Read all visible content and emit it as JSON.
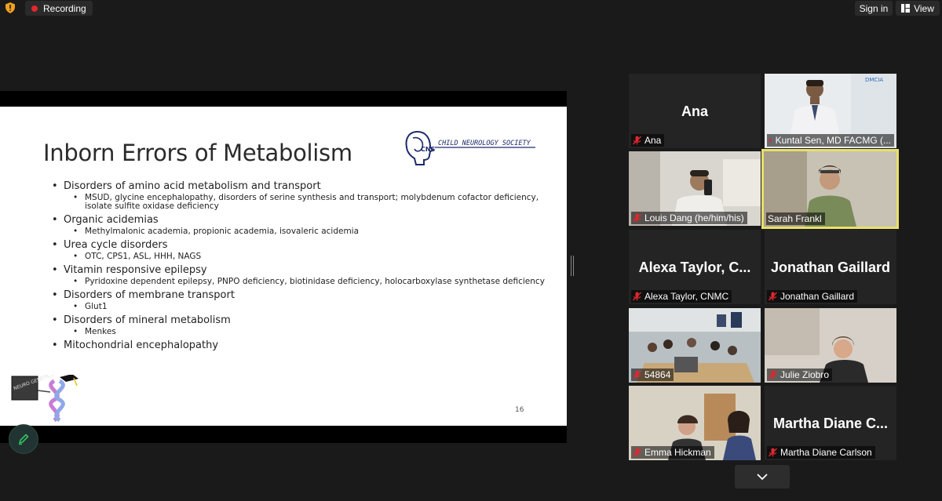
{
  "topbar": {
    "recording_label": "Recording",
    "signin_label": "Sign in",
    "view_label": "View"
  },
  "slide": {
    "title": "Inborn Errors of Metabolism",
    "logo_text": "CHILD NEUROLOGY SOCIETY",
    "logo_mark": "CNS",
    "sticker_text": "NEURO GENETICS",
    "page_number": "16",
    "bullets": [
      {
        "text": "Disorders of amino acid metabolism and transport",
        "sub": "MSUD, glycine encephalopathy, disorders of serine synthesis and transport; molybdenum cofactor deficiency, isolate sulfite oxidase deficiency"
      },
      {
        "text": "Organic acidemias",
        "sub": "Methylmalonic academia, propionic academia, isovaleric acidemia"
      },
      {
        "text": "Urea cycle disorders",
        "sub": "OTC, CPS1, ASL, HHH, NAGS"
      },
      {
        "text": "Vitamin responsive epilepsy",
        "sub": "Pyridoxine dependent epilepsy, PNPO deficiency, biotinidase deficiency, holocarboxylase synthetase deficiency"
      },
      {
        "text": "Disorders of membrane transport",
        "sub": "Glut1"
      },
      {
        "text": "Disorders of mineral metabolism",
        "sub": "Menkes"
      },
      {
        "text": "Mitochondrial encephalopathy",
        "sub": ""
      }
    ]
  },
  "participants": [
    {
      "big_name": "Ana",
      "label": "Ana"
    },
    {
      "big_name": "",
      "label": "Kuntal Sen, MD FACMG (...",
      "video_badge": "DMCIA"
    },
    {
      "big_name": "",
      "label": "Louis Dang (he/him/his)"
    },
    {
      "big_name": "",
      "label": "Sarah Frankl"
    },
    {
      "big_name": "Alexa  Taylor,  C...",
      "label": "Alexa Taylor, CNMC"
    },
    {
      "big_name": "Jonathan Gaillard",
      "label": "Jonathan Gaillard"
    },
    {
      "big_name": "",
      "label": "54864"
    },
    {
      "big_name": "",
      "label": "Julie Ziobro"
    },
    {
      "big_name": "",
      "label": "Emma Hickman"
    },
    {
      "big_name": "Martha  Diane  C...",
      "label": "Martha Diane Carlson"
    }
  ],
  "colors": {
    "recording_dot": "#e0272e",
    "active_speaker_border": "#e8e06b",
    "muted_mic": "#e0272e",
    "background": "#1a1a1a"
  },
  "icons": [
    "shield-icon",
    "record-dot-icon",
    "view-grid-icon",
    "muted-mic-icon",
    "pencil-icon",
    "chevron-down-icon"
  ]
}
